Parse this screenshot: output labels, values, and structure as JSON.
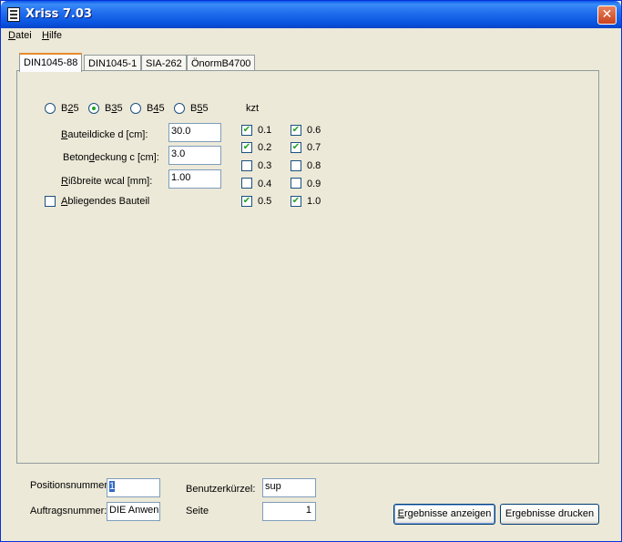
{
  "window": {
    "title": "Xriss 7.03"
  },
  "menu": [
    {
      "label_u": "D",
      "label_rest": "atei"
    },
    {
      "label_u": "H",
      "label_rest": "ilfe"
    }
  ],
  "tabs": [
    "DIN1045-88",
    "DIN1045-1",
    "SIA-262",
    "ÖnormB4700"
  ],
  "concrete": [
    {
      "pre": "B",
      "u": "2",
      "post": "5",
      "checked": false
    },
    {
      "pre": "B",
      "u": "3",
      "post": "5",
      "checked": true
    },
    {
      "pre": "B",
      "u": "4",
      "post": "5",
      "checked": false
    },
    {
      "pre": "B",
      "u": "5",
      "post": "5",
      "checked": false
    }
  ],
  "fields": {
    "bauteildicke": {
      "u": "B",
      "rest": "auteildicke d [cm]:",
      "value": "30.0"
    },
    "betondeckung": {
      "pre": "Beton",
      "u": "d",
      "rest": "eckung c [cm]:",
      "value": "3.0"
    },
    "rissbreite": {
      "u": "R",
      "rest": "ißbreite wcal [mm]:",
      "value": "1.00"
    }
  },
  "abliegend": {
    "u": "A",
    "rest": "bliegendes Bauteil",
    "checked": false
  },
  "kzt": {
    "header": "kzt",
    "left": [
      {
        "label": "0.1",
        "checked": true
      },
      {
        "label": "0.2",
        "checked": true
      },
      {
        "label": "0.3",
        "checked": false
      },
      {
        "label": "0.4",
        "checked": false
      },
      {
        "label": "0.5",
        "checked": true
      }
    ],
    "right": [
      {
        "label": "0.6",
        "checked": true
      },
      {
        "label": "0.7",
        "checked": true
      },
      {
        "label": "0.8",
        "checked": false
      },
      {
        "label": "0.9",
        "checked": false
      },
      {
        "label": "1.0",
        "checked": true
      }
    ]
  },
  "footer": {
    "positionsnummer_label": "Positionsnummer:",
    "positionsnummer_value": "1",
    "auftragsnummer_label": "Auftragsnummer:",
    "auftragsnummer_value": "DIE Anwen",
    "benutzer_label": "Benutzerkürzel:",
    "benutzer_value": "sup",
    "seite_label": "Seite",
    "seite_value": "1",
    "btn_show_u": "E",
    "btn_show_rest": "rgebnisse anzeigen",
    "btn_print": "Ergebnisse drucken"
  },
  "colors": {
    "titlebar": "#0a55e0",
    "face": "#ece9d8",
    "check": "#21a121",
    "tab_accent": "#e68b2c"
  }
}
